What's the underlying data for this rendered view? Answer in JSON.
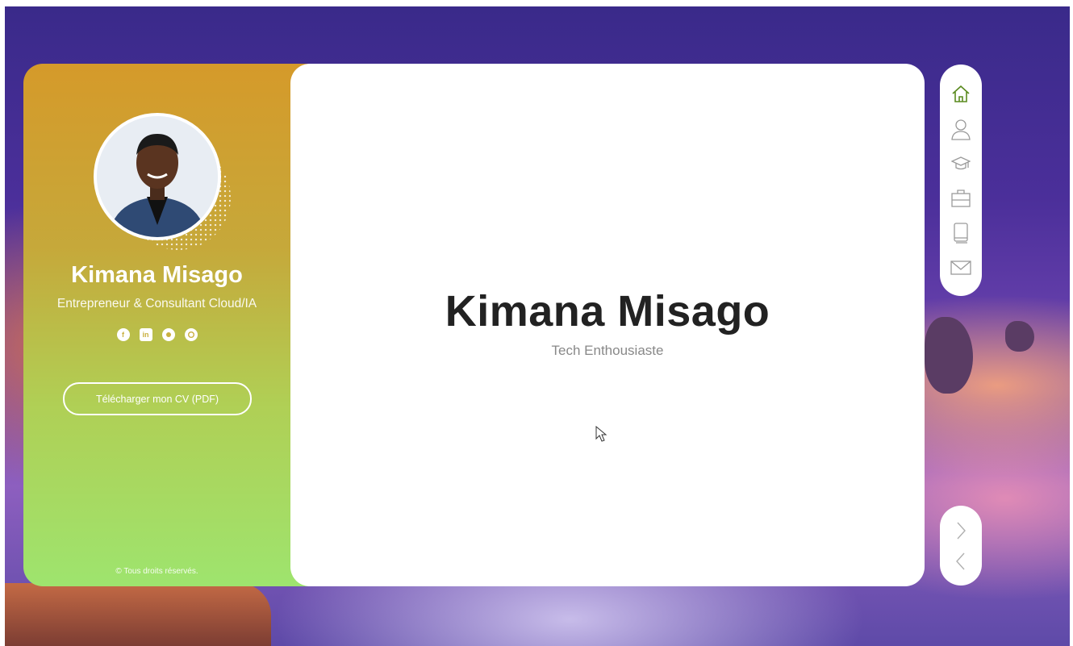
{
  "profile": {
    "name": "Kimana Misago",
    "role": "Entrepreneur & Consultant Cloud/IA",
    "cv_button": "Télécharger mon CV (PDF)",
    "footer": "© Tous droits réservés."
  },
  "socials": [
    {
      "icon": "facebook-icon"
    },
    {
      "icon": "linkedin-icon"
    },
    {
      "icon": "github-icon"
    },
    {
      "icon": "whatsapp-icon"
    }
  ],
  "hero": {
    "title": "Kimana Misago",
    "subtitle": "Tech Enthousiaste"
  },
  "nav": {
    "items": [
      {
        "icon": "home-icon",
        "active": true
      },
      {
        "icon": "user-icon",
        "active": false
      },
      {
        "icon": "graduation-cap-icon",
        "active": false
      },
      {
        "icon": "briefcase-icon",
        "active": false
      },
      {
        "icon": "book-icon",
        "active": false
      },
      {
        "icon": "mail-icon",
        "active": false
      }
    ],
    "next_icon": "chevron-right-icon",
    "prev_icon": "chevron-left-icon"
  },
  "colors": {
    "accent": "#5a8a1f",
    "sidebar_top": "#d59a2a",
    "sidebar_bottom": "#9ee46e",
    "nav_icon": "#9a9a9a"
  }
}
